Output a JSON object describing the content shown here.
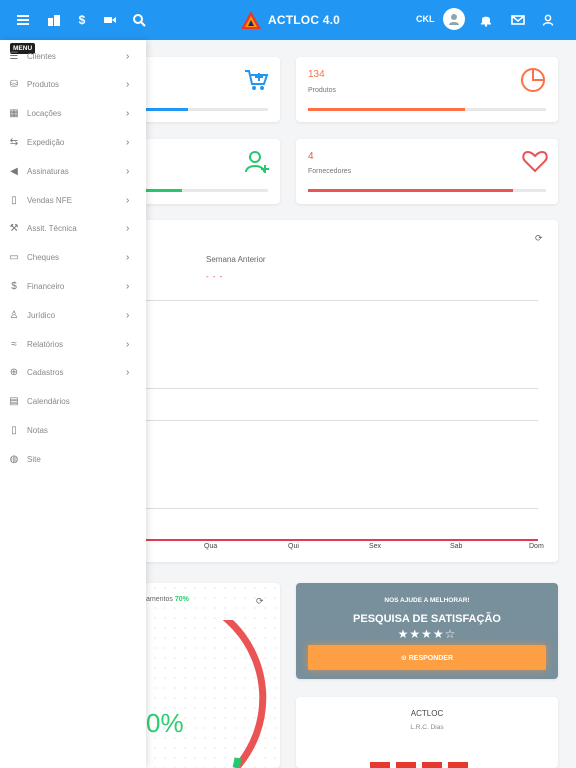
{
  "topbar": {
    "brand": "ACTLOC 4.0",
    "user_name": "CKL",
    "icons": [
      "menu-icon",
      "building-icon",
      "dollar-icon",
      "video-icon",
      "search-icon",
      "avatar",
      "bell-icon",
      "mail-icon",
      "user-icon"
    ],
    "bg_color": "#2196f3"
  },
  "sidebar": {
    "menu_badge": "MENU",
    "items": [
      {
        "label": "Clientes",
        "icon": "users-icon",
        "has_submenu": true
      },
      {
        "label": "Produtos",
        "icon": "database-icon",
        "has_submenu": true
      },
      {
        "label": "Locações",
        "icon": "calendar-icon",
        "has_submenu": true
      },
      {
        "label": "Expedição",
        "icon": "truck-icon",
        "has_submenu": true
      },
      {
        "label": "Assinaturas",
        "icon": "megaphone-icon",
        "has_submenu": true
      },
      {
        "label": "Vendas NFE",
        "icon": "document-icon",
        "has_submenu": true
      },
      {
        "label": "Assit. Técnica",
        "icon": "wrench-icon",
        "has_submenu": true
      },
      {
        "label": "Cheques",
        "icon": "card-icon",
        "has_submenu": true
      },
      {
        "label": "Financeiro",
        "icon": "dollar-icon",
        "has_submenu": true
      },
      {
        "label": "Jurídico",
        "icon": "person-icon",
        "has_submenu": true
      },
      {
        "label": "Relatórios",
        "icon": "chart-icon",
        "has_submenu": true
      },
      {
        "label": "Cadastros",
        "icon": "circle-plus-icon",
        "has_submenu": true
      },
      {
        "label": "Calendários",
        "icon": "calendar-grid-icon",
        "has_submenu": false
      },
      {
        "label": "Notas",
        "icon": "note-icon",
        "has_submenu": false
      },
      {
        "label": "Site",
        "icon": "globe-icon",
        "has_submenu": false
      }
    ]
  },
  "stats": [
    {
      "value": "",
      "label": "",
      "color": "#2196f3",
      "progress": 0.63,
      "icon": "cart-icon"
    },
    {
      "value": "134",
      "label": "Produtos",
      "color": "#ff7043",
      "progress": 0.66,
      "icon": "pie-chart-icon"
    },
    {
      "value": "",
      "label": "",
      "color": "#28c76f",
      "progress": 0.6,
      "icon": "user-plus-icon"
    },
    {
      "value": "4",
      "label": "Fornecedores",
      "color": "#ea5455",
      "progress": 0.86,
      "icon": "heart-icon"
    }
  ],
  "weekly_chart": {
    "legend_label": "Semana Anterior",
    "legend_dash": "- - -",
    "x_ticks": [
      "Qua",
      "Qui",
      "Sex",
      "Sab",
      "Dom"
    ]
  },
  "donut": {
    "title_suffix": "amentos",
    "title_pct": "70%",
    "big_value": "0%",
    "colors": {
      "main": "#ea5455",
      "accent": "#28c76f"
    }
  },
  "survey": {
    "top_text": "NOS AJUDE A MELHORAR!",
    "title": "PESQUISA DE SATISFAÇÃO",
    "stars": "★★★★☆",
    "button_label": "⊙ RESPONDER"
  },
  "company": {
    "name": "ACTLOC",
    "sub": "L.R.C. Dias"
  }
}
